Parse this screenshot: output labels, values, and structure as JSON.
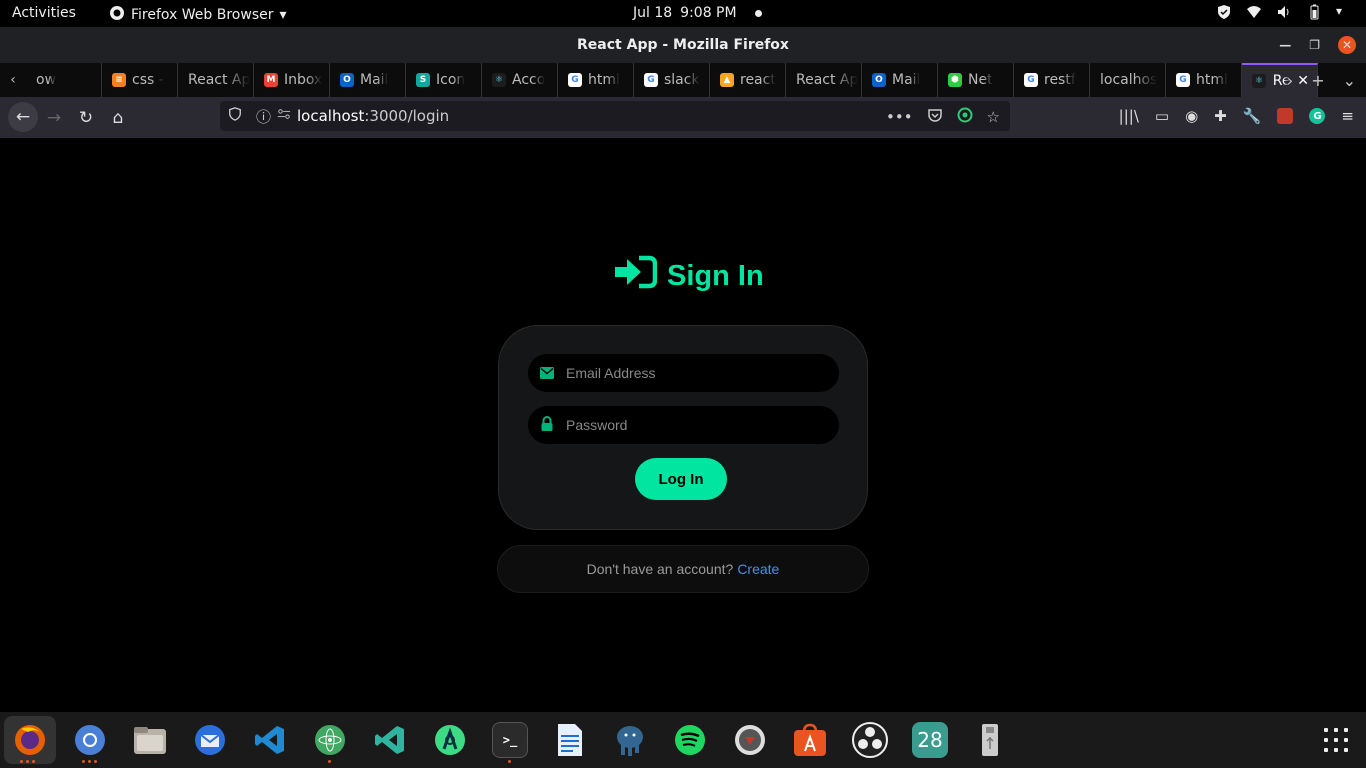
{
  "topbar": {
    "activities": "Activities",
    "app_name": "Firefox Web Browser",
    "date": "Jul 18",
    "time": "9:08 PM"
  },
  "window": {
    "title": "React App - Mozilla Firefox"
  },
  "tabs": [
    {
      "label": "ow",
      "favicon": "partial"
    },
    {
      "label": "css -",
      "favicon": "stackoverflow-icon"
    },
    {
      "label": "React Ap",
      "favicon": "none"
    },
    {
      "label": "Inbox",
      "favicon": "gmail-icon"
    },
    {
      "label": "Mail",
      "favicon": "outlook-icon"
    },
    {
      "label": "Icon",
      "favicon": "s-icon"
    },
    {
      "label": "Acco",
      "favicon": "react-icon"
    },
    {
      "label": "html",
      "favicon": "google-icon"
    },
    {
      "label": "slack",
      "favicon": "google-icon"
    },
    {
      "label": "react",
      "favicon": "firebase-icon"
    },
    {
      "label": "React Ap",
      "favicon": "none"
    },
    {
      "label": "Mail",
      "favicon": "outlook-icon"
    },
    {
      "label": "Net",
      "favicon": "node-icon"
    },
    {
      "label": "restf",
      "favicon": "google-icon"
    },
    {
      "label": "localhos",
      "favicon": "none"
    },
    {
      "label": "html",
      "favicon": "google-icon"
    },
    {
      "label": "Re",
      "favicon": "react-icon"
    }
  ],
  "url": {
    "host": "localhost",
    "path": ":3000/login"
  },
  "page": {
    "heading": "Sign In",
    "email_placeholder": "Email Address",
    "password_placeholder": "Password",
    "login_label": "Log In",
    "signup_prompt": "Don't have an account?",
    "signup_link": "Create"
  },
  "dock": {
    "calendar_day": "28"
  },
  "colors": {
    "accent": "#00e5a0",
    "link": "#4a90e2",
    "tab_active_border": "#9059ff"
  }
}
